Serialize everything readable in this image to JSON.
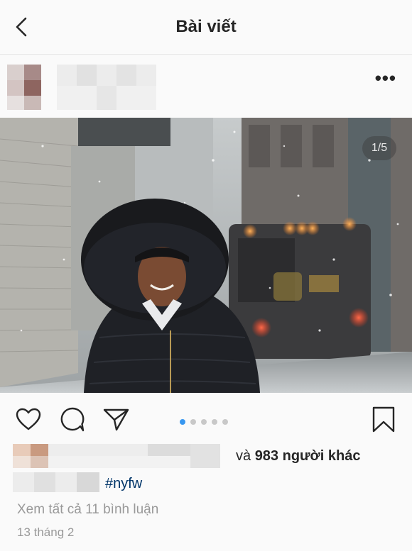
{
  "header": {
    "title": "Bài viết",
    "back_icon": "chevron-left-icon"
  },
  "post": {
    "more_icon": "more-horizontal-icon",
    "more_label": "•••",
    "image": {
      "counter": "1/5",
      "description": "photo"
    },
    "actions": {
      "like_icon": "heart-icon",
      "comment_icon": "comment-icon",
      "share_icon": "send-icon",
      "save_icon": "bookmark-icon"
    },
    "carousel": {
      "total": 5,
      "active_index": 0
    },
    "likes": {
      "prefix": "và ",
      "count_text": "983 người khác"
    },
    "caption": {
      "hashtag": "#nyfw"
    },
    "comments_link": "Xem tất cả 11 bình luận",
    "date": "13 tháng 2"
  },
  "colors": {
    "accent": "#3897f0",
    "hashtag": "#003569",
    "muted": "#999999",
    "text": "#262626"
  }
}
